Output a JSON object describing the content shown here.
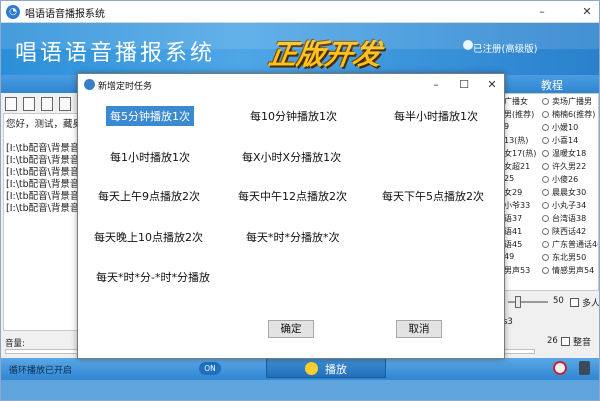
{
  "app": {
    "title": "唱语语音播报系统",
    "banner_title": "唱语语音播报系统",
    "banner_badge": "正版开发",
    "registration_status": "已注册(高级版)",
    "nav_tab": "教程"
  },
  "left_panel": {
    "lines": [
      "您好，测试，藏奥",
      "[I:\\tb配音\\背景音",
      "[I:\\tb配音\\背景音",
      "[I:\\tb配音\\背景音",
      "[I:\\tb配音\\背景音",
      "[I:\\tb配音\\背景音",
      "[I:\\tb配音\\背景音"
    ]
  },
  "right_list": {
    "rows": [
      {
        "left": "广播女",
        "right": "卖场广播男"
      },
      {
        "left": "男(推荐)",
        "right": "楠楠6(推荐)"
      },
      {
        "left": "9",
        "right": "小媛10"
      },
      {
        "left": "13(热)",
        "right": "小喜14"
      },
      {
        "left": "女17(热)",
        "right": "温暖女18"
      },
      {
        "left": "女超21",
        "right": "许久男22"
      },
      {
        "left": "25",
        "right": "小傻26"
      },
      {
        "left": "女29",
        "right": "晨晨女30"
      },
      {
        "left": "小爷33",
        "right": "小丸子34"
      },
      {
        "left": "语37",
        "right": "台湾语38"
      },
      {
        "left": "语41",
        "right": "陕西话42"
      },
      {
        "left": "语45",
        "right": "广东普通话46"
      },
      {
        "left": "49",
        "right": "东北男50"
      },
      {
        "left": "男声53",
        "right": "情感男声54"
      }
    ],
    "speed_value": "50",
    "multi_label": "多人",
    "s3": "s3",
    "ambient_label": "整音"
  },
  "bottom": {
    "volume_label": "音量:",
    "volume_min": "0",
    "volume_value": "26",
    "volume_level": 0.05,
    "status_text": "循环播放已开启",
    "toggle_label": "ON",
    "play_label": "播放"
  },
  "dialog": {
    "title": "新增定时任务",
    "options": [
      "每5分钟播放1次",
      "每10分钟播放1次",
      "每半小时播放1次",
      "每1小时播放1次",
      "每X小时X分播放1次",
      "每天上午9点播放2次",
      "每天中午12点播放2次",
      "每天下午5点播放2次",
      "每天晚上10点播放2次",
      "每天*时*分播放*次",
      "每天*时*分-*时*分播放"
    ],
    "selected_index": 0,
    "ok_label": "确定",
    "cancel_label": "取消"
  },
  "colors": {
    "banner": "#3a93da",
    "badge": "#ffc21a",
    "selection": "#3b89d1"
  }
}
